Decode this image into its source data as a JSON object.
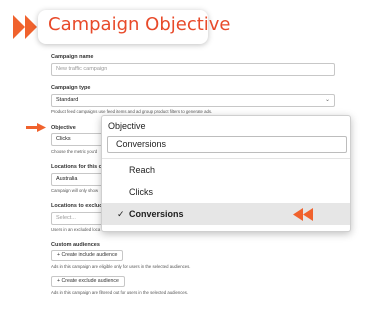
{
  "header": {
    "title": "Campaign Objective"
  },
  "form": {
    "campaign_name": {
      "label": "Campaign name",
      "placeholder": "New traffic campaign"
    },
    "campaign_type": {
      "label": "Campaign type",
      "value": "Standard",
      "hint": "Product feed campaigns use feed items and ad group product filters to generate ads."
    },
    "objective": {
      "label": "Objective",
      "value": "Clicks",
      "hint": "Choose the metric you'd"
    },
    "locations": {
      "label": "Locations for this cam",
      "value": "Australia",
      "hint": "Campaign will only show"
    },
    "exclude_locations": {
      "label": "Locations to exclude f",
      "placeholder": "Select...",
      "hint": "Users in an excluded loca"
    },
    "custom_audiences": {
      "label": "Custom audiences",
      "include_button": "+ Create include audience",
      "include_hint": "Ads in this campaign are eligible only for users in the selected audiences.",
      "exclude_button": "+ Create exclude audience",
      "exclude_hint": "Ads in this campaign are filtered out for users in the selected audiences."
    }
  },
  "popup": {
    "title": "Objective",
    "current": "Conversions",
    "options": [
      {
        "label": "Reach",
        "selected": false
      },
      {
        "label": "Clicks",
        "selected": false
      },
      {
        "label": "Conversions",
        "selected": true
      }
    ],
    "check_glyph": "✓"
  },
  "colors": {
    "accent": "#e84a2a",
    "arrow": "#f0622d"
  }
}
